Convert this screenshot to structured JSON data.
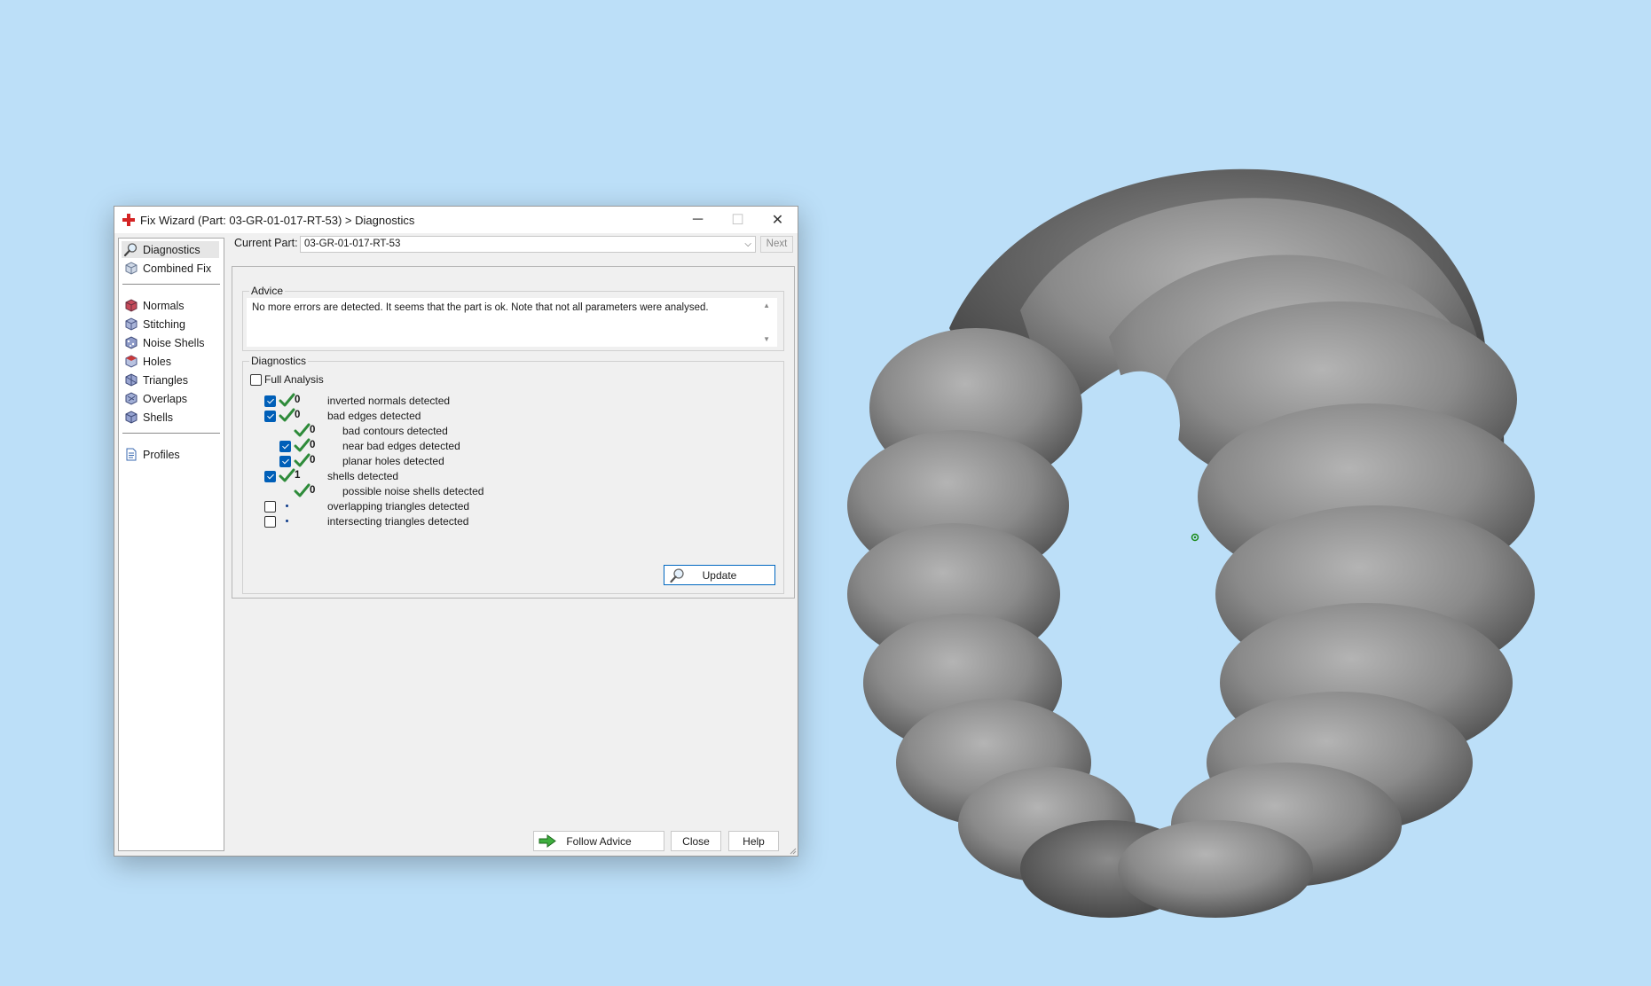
{
  "dialog": {
    "title": "Fix Wizard (Part: 03-GR-01-017-RT-53) > Diagnostics",
    "window_controls": {
      "minimize": "─",
      "maximize": "☐",
      "close": "✕"
    }
  },
  "nav": {
    "items": [
      {
        "label": "Diagnostics",
        "icon": "magnifier-icon",
        "selected": true
      },
      {
        "label": "Combined Fix",
        "icon": "cube-icon"
      },
      {
        "label": "Normals",
        "icon": "normals-cube-icon"
      },
      {
        "label": "Stitching",
        "icon": "stitching-cube-icon"
      },
      {
        "label": "Noise Shells",
        "icon": "noise-shells-icon"
      },
      {
        "label": "Holes",
        "icon": "holes-cube-icon"
      },
      {
        "label": "Triangles",
        "icon": "triangles-cube-icon"
      },
      {
        "label": "Overlaps",
        "icon": "overlaps-cube-icon"
      },
      {
        "label": "Shells",
        "icon": "shells-cube-icon"
      },
      {
        "label": "Profiles",
        "icon": "document-icon"
      }
    ]
  },
  "current_part": {
    "label": "Current Part:",
    "value": "03-GR-01-017-RT-53",
    "next_label": "Next"
  },
  "advice": {
    "title": "Advice",
    "text": "No more errors are detected. It seems that the part is ok. Note that not all parameters were analysed."
  },
  "diagnostics": {
    "title": "Diagnostics",
    "full_analysis_label": "Full Analysis",
    "full_analysis_checked": false,
    "rows": [
      {
        "checked": true,
        "status": "ok",
        "count": "0",
        "label": "inverted normals detected",
        "indent": 0
      },
      {
        "checked": true,
        "status": "ok",
        "count": "0",
        "label": "bad edges detected",
        "indent": 0
      },
      {
        "checked": null,
        "status": "ok",
        "count": "0",
        "label": "bad contours detected",
        "indent": 1
      },
      {
        "checked": true,
        "status": "ok",
        "count": "0",
        "label": "near bad edges detected",
        "indent": 1
      },
      {
        "checked": true,
        "status": "ok",
        "count": "0",
        "label": "planar holes detected",
        "indent": 1
      },
      {
        "checked": true,
        "status": "ok",
        "count": "1",
        "label": "shells detected",
        "indent": 0
      },
      {
        "checked": null,
        "status": "ok",
        "count": "0",
        "label": "possible noise shells detected",
        "indent": 1
      },
      {
        "checked": false,
        "status": "none",
        "count": "",
        "label": "overlapping triangles detected",
        "indent": 0
      },
      {
        "checked": false,
        "status": "none",
        "count": "",
        "label": "intersecting triangles detected",
        "indent": 0
      }
    ],
    "update_label": "Update"
  },
  "buttons": {
    "follow_advice": "Follow Advice",
    "close": "Close",
    "help": "Help"
  },
  "colors": {
    "desktop_bg": "#bcdff8",
    "check_green": "#2e8b3a",
    "checkbox_blue": "#005fb8",
    "ring_gray": "#8c8c8c"
  }
}
